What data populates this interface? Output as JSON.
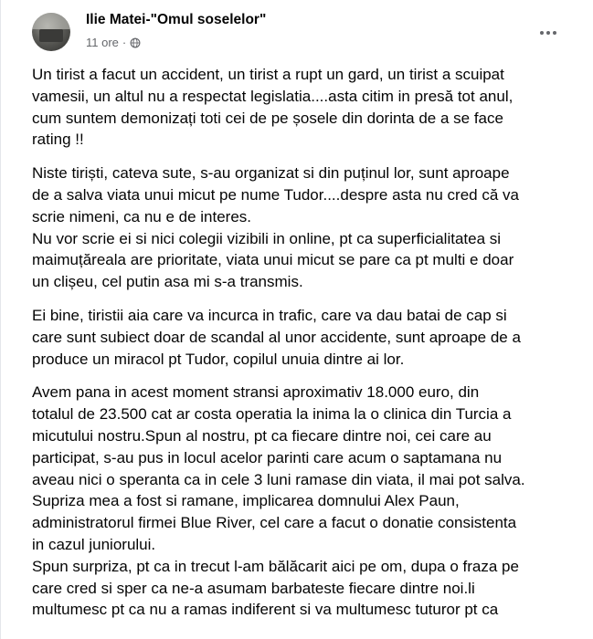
{
  "post": {
    "author": "Ilie Matei-\"Omul soselelor\"",
    "time": "11 ore",
    "separator": "·",
    "paragraphs": [
      [
        "Un tirist a facut un accident, un tirist a rupt un gard, un tirist a scuipat",
        "vamesii, un altul nu a respectat legislatia....asta citim in presă tot anul,",
        "cum suntem demonizați toti cei de pe șosele din dorinta de a se face",
        "rating !!"
      ],
      [
        "Niste tiriști, cateva sute, s-au organizat si din puținul lor, sunt aproape",
        "de a salva viata unui micut pe nume Tudor....despre asta nu cred că va",
        "scrie nimeni, ca nu e de interes.",
        "Nu vor scrie ei si nici colegii vizibili in online, pt ca superficialitatea si",
        "maimuțăreala are prioritate, viata unui micut se pare ca pt multi e doar",
        "un clișeu, cel putin asa mi s-a transmis."
      ],
      [
        "Ei bine, tiristii aia care va incurca in trafic, care va dau batai de cap si",
        "care sunt subiect doar de scandal al unor accidente, sunt aproape de a",
        "produce un miracol pt Tudor, copilul unuia dintre ai lor."
      ],
      [
        "Avem pana in acest moment stransi aproximativ 18.000 euro, din",
        "totalul de 23.500 cat ar costa operatia la inima la o clinica din Turcia a",
        "micutului nostru.Spun al nostru, pt ca fiecare dintre noi, cei care au",
        "participat, s-au pus in locul acelor parinti care acum o saptamana nu",
        "aveau nici o speranta ca in cele 3 luni ramase din viata, il mai pot salva.",
        "Supriza mea a fost si ramane, implicarea domnului Alex Paun,",
        "administratorul firmei Blue River, cel care a facut o donatie consistenta",
        "in cazul juniorului.",
        "Spun surpriza, pt ca in trecut l-am bălăcarit aici pe om, dupa o fraza pe",
        "care cred si sper ca ne-a asumam barbateste fiecare dintre noi.li",
        "multumesc pt ca nu a ramas indiferent si va multumesc tuturor pt ca"
      ]
    ]
  },
  "icons": {
    "globe": "globe-icon",
    "more": "more-options-icon"
  }
}
